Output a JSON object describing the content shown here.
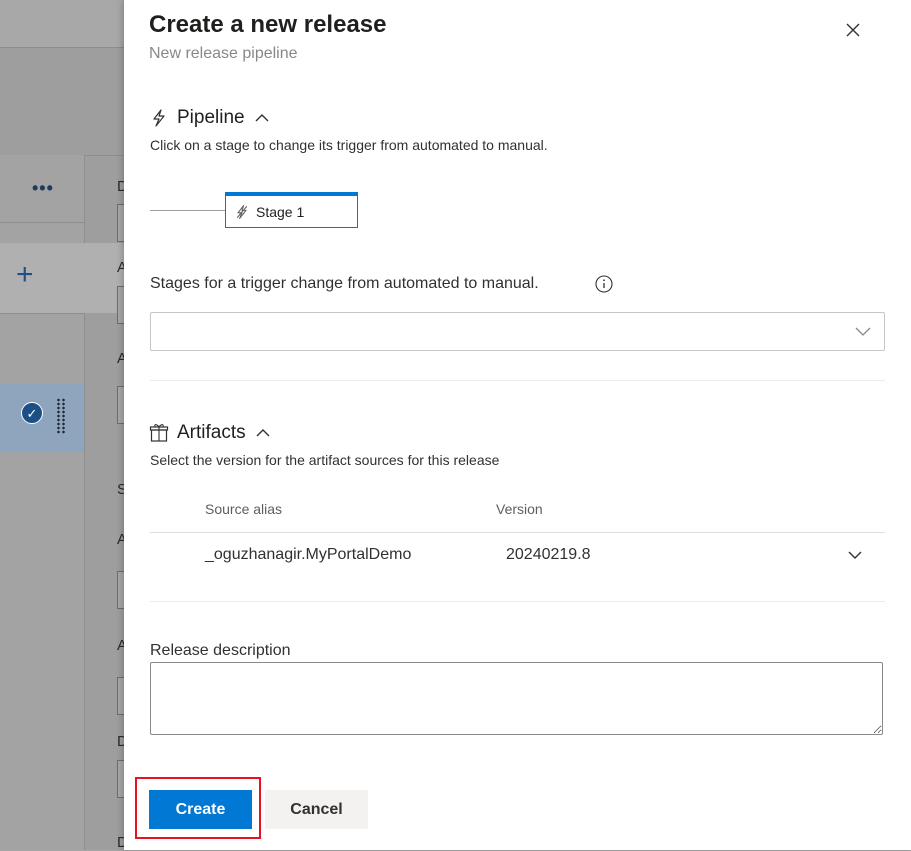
{
  "background": {
    "more_label": "•••",
    "add_label": "+",
    "check_label": "✓",
    "side_letters": [
      "D",
      "A",
      "A",
      "S",
      "A",
      "A",
      "D",
      "D"
    ]
  },
  "dialog": {
    "title": "Create a new release",
    "subtitle": "New release pipeline",
    "close_icon": "close-icon"
  },
  "pipeline": {
    "heading": "Pipeline",
    "description": "Click on a stage to change its trigger from automated to manual.",
    "stage_name": "Stage 1",
    "trigger_label": "Stages for a trigger change from automated to manual.",
    "trigger_selected": ""
  },
  "artifacts": {
    "heading": "Artifacts",
    "description": "Select the version for the artifact sources for this release",
    "columns": [
      "Source alias",
      "Version"
    ],
    "rows": [
      {
        "source_alias": "_oguzhanagir.MyPortalDemo",
        "version": "20240219.8"
      }
    ]
  },
  "release_description": {
    "label": "Release description",
    "value": ""
  },
  "buttons": {
    "create": "Create",
    "cancel": "Cancel"
  },
  "colors": {
    "accent": "#0078d4",
    "highlight": "#e81123"
  }
}
